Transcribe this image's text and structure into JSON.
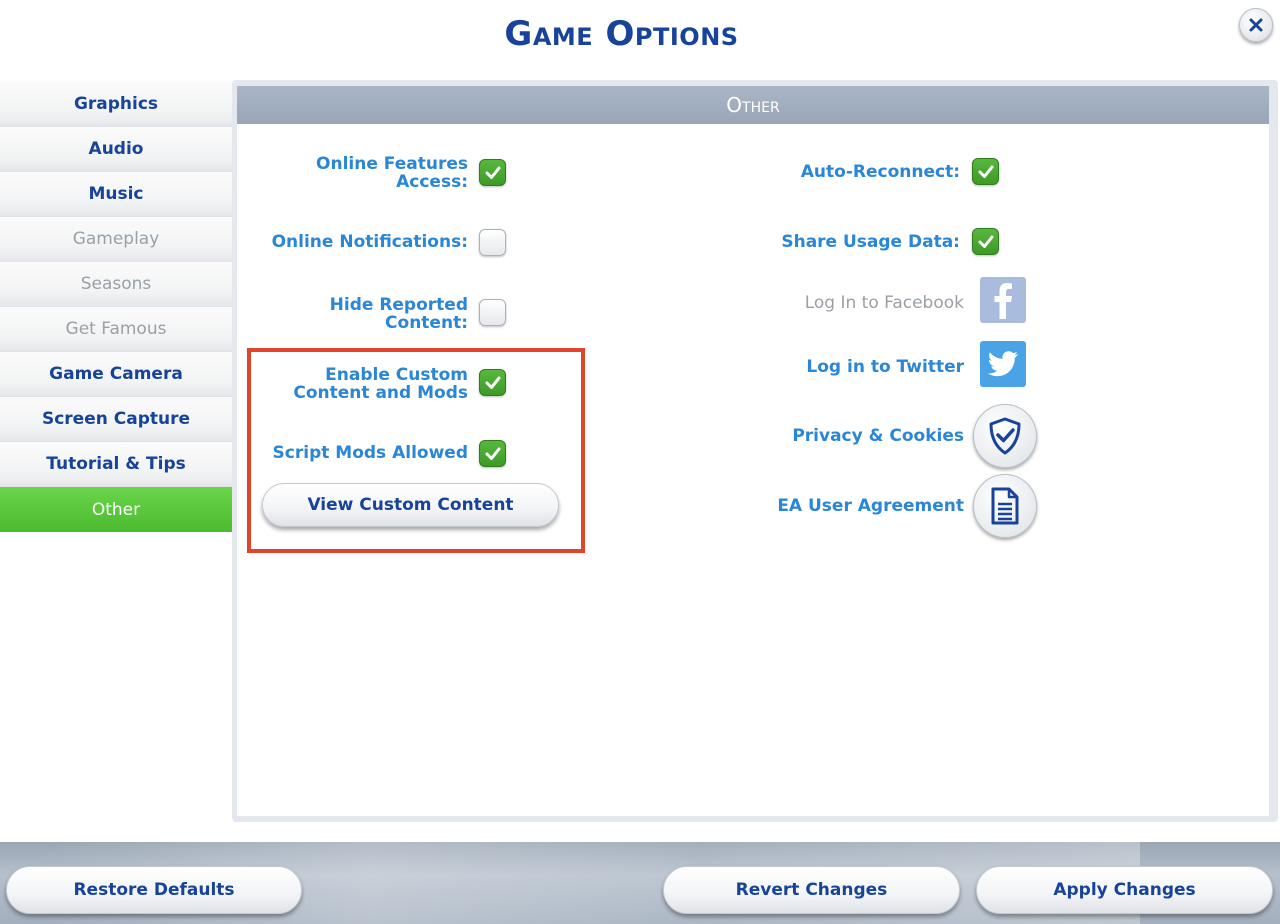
{
  "window": {
    "title": "Game Options",
    "close_icon": "close-icon"
  },
  "sidebar": {
    "items": [
      {
        "label": "Graphics",
        "state": "normal"
      },
      {
        "label": "Audio",
        "state": "normal"
      },
      {
        "label": "Music",
        "state": "normal"
      },
      {
        "label": "Gameplay",
        "state": "disabled"
      },
      {
        "label": "Seasons",
        "state": "disabled"
      },
      {
        "label": "Get Famous",
        "state": "disabled"
      },
      {
        "label": "Game Camera",
        "state": "normal"
      },
      {
        "label": "Screen Capture",
        "state": "normal"
      },
      {
        "label": "Tutorial & Tips",
        "state": "normal"
      },
      {
        "label": "Other",
        "state": "active"
      }
    ]
  },
  "panel": {
    "header": "Other",
    "left_options": [
      {
        "label_line1": "Online Features",
        "label_line2": "Access:",
        "checked": true
      },
      {
        "label_line1": "Online Notifications:",
        "label_line2": "",
        "checked": false
      },
      {
        "label_line1": "Hide Reported",
        "label_line2": "Content:",
        "checked": false
      },
      {
        "label_line1": "Enable Custom",
        "label_line2": "Content and Mods",
        "checked": true
      },
      {
        "label_line1": "Script Mods Allowed",
        "label_line2": "",
        "checked": true
      }
    ],
    "view_custom_content": "View Custom Content",
    "right_options": [
      {
        "label": "Auto-Reconnect:",
        "checked": true
      },
      {
        "label": "Share Usage Data:",
        "checked": true
      }
    ],
    "links": {
      "facebook": {
        "label": "Log In to Facebook",
        "icon": "facebook-icon",
        "enabled": false
      },
      "twitter": {
        "label": "Log in to Twitter",
        "icon": "twitter-icon",
        "enabled": true
      },
      "privacy": {
        "label": "Privacy & Cookies",
        "icon": "shield-check-icon"
      },
      "agreement": {
        "label": "EA User Agreement",
        "icon": "document-icon"
      }
    }
  },
  "footer": {
    "restore_defaults": "Restore Defaults",
    "revert_changes": "Revert Changes",
    "apply_changes": "Apply Changes"
  },
  "colors": {
    "title_blue": "#17439a",
    "label_blue": "#2a86d6",
    "active_green": "#56c43a",
    "check_green": "#3c9a26",
    "highlight_red": "#e0442a",
    "header_gray": "#a3b0c1"
  }
}
